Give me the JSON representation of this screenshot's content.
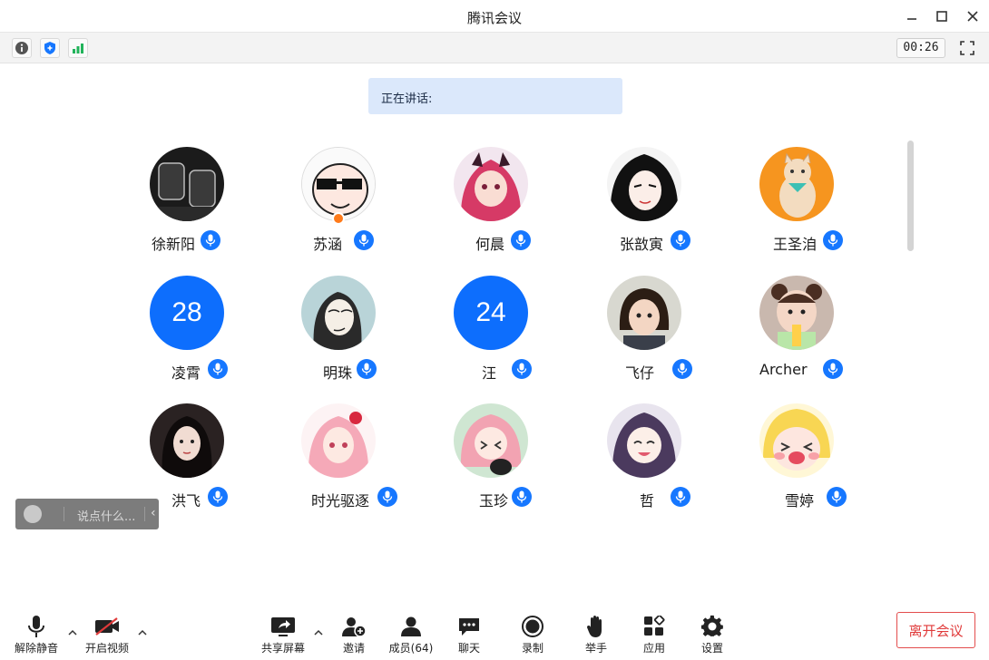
{
  "window": {
    "title": "腾讯会议"
  },
  "infobar": {
    "timer": "00:26"
  },
  "speaking": {
    "label": "正在讲话:"
  },
  "participants": [
    {
      "name": "徐新阳",
      "avatar": "photo-glasses"
    },
    {
      "name": "苏涵",
      "avatar": "cartoon-sunglasses"
    },
    {
      "name": "何晨",
      "avatar": "anime-redhair"
    },
    {
      "name": "张敨寅",
      "avatar": "anime-blackhair"
    },
    {
      "name": "王圣洎",
      "avatar": "cat-cartoon"
    },
    {
      "name": "凌霄",
      "avatar_number": "28"
    },
    {
      "name": "明珠",
      "avatar": "sketch-person"
    },
    {
      "name": "汪",
      "avatar_number": "24"
    },
    {
      "name": "飞仔",
      "avatar": "photo-child"
    },
    {
      "name": "Archer",
      "avatar": "photo-baby"
    },
    {
      "name": "洪飞",
      "avatar": "photo-girl"
    },
    {
      "name": "时光驱逐",
      "avatar": "anime-pinkhair"
    },
    {
      "name": "玉珍",
      "avatar": "anime-pink-cat"
    },
    {
      "name": "哲",
      "avatar": "anime-purplehair"
    },
    {
      "name": "雪婷",
      "avatar": "anime-blush"
    }
  ],
  "chat": {
    "placeholder": "说点什么..."
  },
  "toolbar": {
    "unmute": "解除静音",
    "start_video": "开启视频",
    "share_screen": "共享屏幕",
    "invite": "邀请",
    "members": "成员(64)",
    "chat": "聊天",
    "record": "录制",
    "raise_hand": "举手",
    "apps": "应用",
    "settings": "设置",
    "leave": "离开会议"
  },
  "colors": {
    "accent": "#1677ff",
    "leave": "#e03a3a",
    "banner": "#dbe8fb"
  }
}
